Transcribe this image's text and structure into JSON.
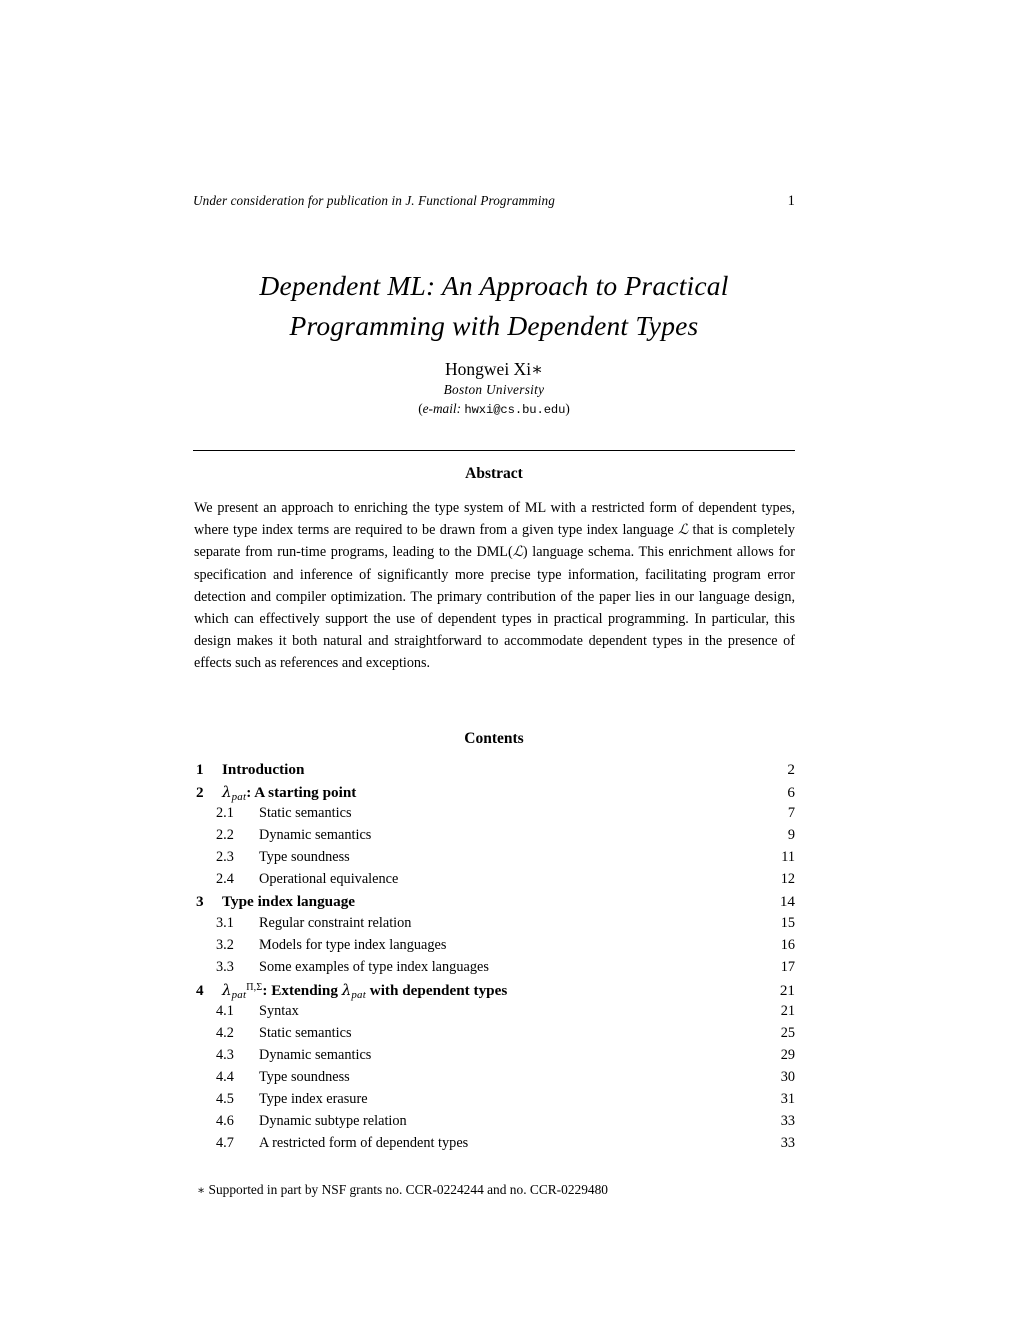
{
  "header": {
    "running_title": "Under consideration for publication in J. Functional Programming",
    "folio": "1"
  },
  "title": {
    "line1": "Dependent ML: An Approach to Practical",
    "line2": "Programming with Dependent Types"
  },
  "author": {
    "name": "Hongwei Xi",
    "name_marker": "∗",
    "affiliation": "Boston University",
    "email_open": "(",
    "email_label": "e-mail:",
    "email_address": "hwxi@cs.bu.edu",
    "email_close": ")"
  },
  "abstract": {
    "heading": "Abstract",
    "paragraph_part1": "We present an approach to enriching the type system of ML with a restricted form of dependent types, where type index terms are required to be drawn from a given type index language ",
    "symbol_L": "ℒ",
    "paragraph_part2": " that is completely separate from run-time programs, leading to the DML(",
    "paragraph_part3": ") language schema. This enrichment allows for specification and inference of significantly more precise type information, facilitating program error detection and compiler optimization. The primary contribution of the paper lies in our language design, which can effectively support the use of dependent types in practical programming. In particular, this design makes it both natural and straightforward to accommodate dependent types in the presence of effects such as references and exceptions."
  },
  "contents": {
    "heading": "Contents",
    "entries": [
      {
        "level": "section",
        "number": "1",
        "label": "Introduction",
        "page": "2"
      },
      {
        "level": "section",
        "number": "2",
        "label": "λ_pat: A starting point",
        "label_pre": "",
        "math": "lambda_pat",
        "label_post": ": A starting point",
        "page": "6"
      },
      {
        "level": "subsection",
        "number": "2.1",
        "label": "Static semantics",
        "page": "7"
      },
      {
        "level": "subsection",
        "number": "2.2",
        "label": "Dynamic semantics",
        "page": "9"
      },
      {
        "level": "subsection",
        "number": "2.3",
        "label": "Type soundness",
        "page": "11"
      },
      {
        "level": "subsection",
        "number": "2.4",
        "label": "Operational equivalence",
        "page": "12"
      },
      {
        "level": "section",
        "number": "3",
        "label": "Type index language",
        "page": "14"
      },
      {
        "level": "subsection",
        "number": "3.1",
        "label": "Regular constraint relation",
        "page": "15"
      },
      {
        "level": "subsection",
        "number": "3.2",
        "label": "Models for type index languages",
        "page": "16"
      },
      {
        "level": "subsection",
        "number": "3.3",
        "label": "Some examples of type index languages",
        "page": "17"
      },
      {
        "level": "section",
        "number": "4",
        "label": "λ^{Π,Σ}_pat: Extending λ_pat with dependent types",
        "math": "lambda_pat_pisigma",
        "page": "21"
      },
      {
        "level": "subsection",
        "number": "4.1",
        "label": "Syntax",
        "page": "21"
      },
      {
        "level": "subsection",
        "number": "4.2",
        "label": "Static semantics",
        "page": "25"
      },
      {
        "level": "subsection",
        "number": "4.3",
        "label": "Dynamic semantics",
        "page": "29"
      },
      {
        "level": "subsection",
        "number": "4.4",
        "label": "Type soundness",
        "page": "30"
      },
      {
        "level": "subsection",
        "number": "4.5",
        "label": "Type index erasure",
        "page": "31"
      },
      {
        "level": "subsection",
        "number": "4.6",
        "label": "Dynamic subtype relation",
        "page": "33"
      },
      {
        "level": "subsection",
        "number": "4.7",
        "label": "A restricted form of dependent types",
        "page": "33"
      }
    ],
    "math_labels": {
      "lambda_symbol": "λ",
      "subscript_pat": "pat",
      "superscript_pisigma": "Π,Σ",
      "entry2_suffix": ": A starting point",
      "entry4_middle": ": Extending ",
      "entry4_suffix": " with dependent types"
    }
  },
  "footnote": {
    "marker": "∗",
    "text": "Supported in part by NSF grants no. CCR-0224244 and no. CCR-0229480"
  }
}
